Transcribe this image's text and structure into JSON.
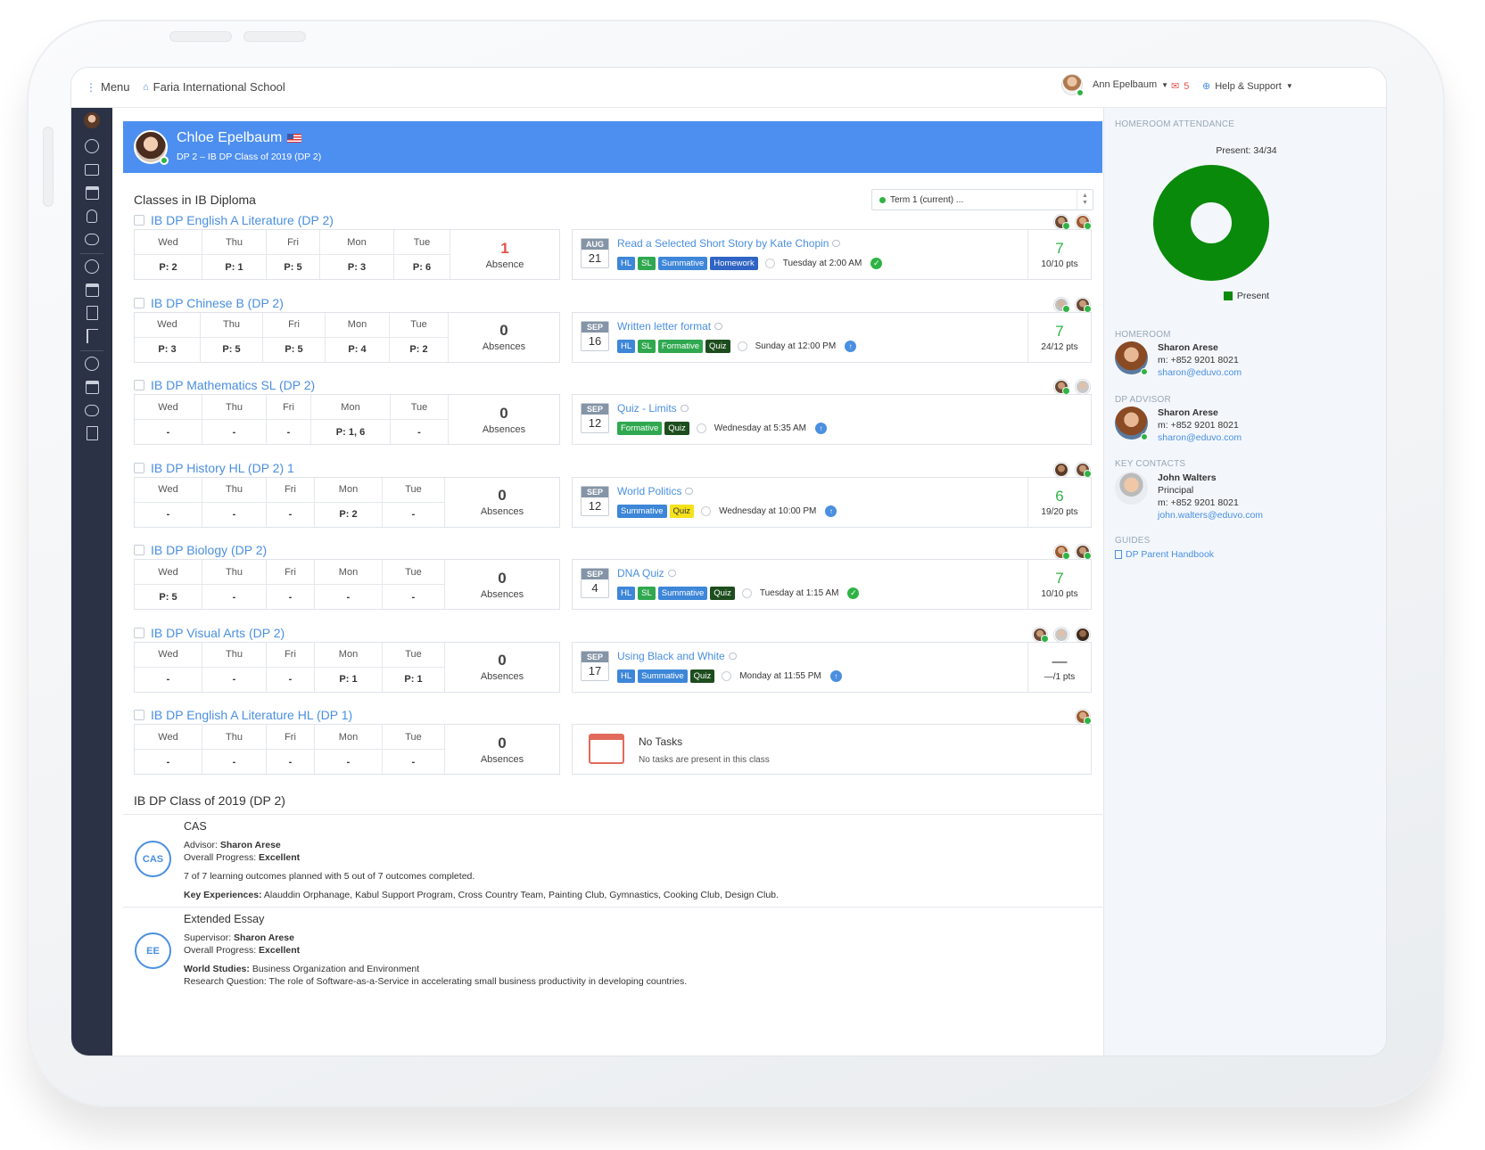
{
  "topbar": {
    "menu_label": "Menu",
    "school_name": "Faria International School",
    "user_name": "Ann Epelbaum",
    "messages_count": "5",
    "help_label": "Help & Support"
  },
  "student": {
    "name": "Chloe Epelbaum",
    "subtitle": "DP 2 – IB DP Class of 2019 (DP 2)"
  },
  "classes_section": {
    "title": "Classes in IB Diploma",
    "term_select": "Term 1 (current) ..."
  },
  "classes": [
    {
      "title": "IB DP English A Literature (DP 2)",
      "attendance": [
        [
          "Wed",
          "P: 2"
        ],
        [
          "Thu",
          "P: 1"
        ],
        [
          "Fri",
          "P: 5"
        ],
        [
          "Mon",
          "P: 3"
        ],
        [
          "Tue",
          "P: 6"
        ]
      ],
      "absence_count": "1",
      "absence_label": "Absence",
      "task": {
        "month": "AUG",
        "day": "21",
        "title": "Read a Selected Short Story by Kate Chopin",
        "tags": [
          "HL",
          "SL",
          "Summative",
          "Homework"
        ],
        "due": "Tuesday at 2:00 AM",
        "status": "done",
        "score": "7",
        "points": "10/10 pts"
      }
    },
    {
      "title": "IB DP Chinese B (DP 2)",
      "attendance": [
        [
          "Wed",
          "P: 3"
        ],
        [
          "Thu",
          "P: 5"
        ],
        [
          "Fri",
          "P: 5"
        ],
        [
          "Mon",
          "P: 4"
        ],
        [
          "Tue",
          "P: 2"
        ]
      ],
      "absence_count": "0",
      "absence_label": "Absences",
      "task": {
        "month": "SEP",
        "day": "16",
        "title": "Written letter format",
        "tags": [
          "HL",
          "SL",
          "Formative",
          "Quiz"
        ],
        "due": "Sunday at 12:00 PM",
        "status": "upload",
        "score": "7",
        "points": "24/12 pts"
      }
    },
    {
      "title": "IB DP Mathematics SL (DP 2)",
      "attendance": [
        [
          "Wed",
          "-"
        ],
        [
          "Thu",
          "-"
        ],
        [
          "Fri",
          "-"
        ],
        [
          "Mon",
          "P: 1, 6"
        ],
        [
          "Tue",
          "-"
        ]
      ],
      "absence_count": "0",
      "absence_label": "Absences",
      "task": {
        "month": "SEP",
        "day": "12",
        "title": "Quiz - Limits",
        "tags": [
          "Formative",
          "Quiz"
        ],
        "due": "Wednesday at 5:35 AM",
        "status": "upload",
        "score": "",
        "points": ""
      }
    },
    {
      "title": "IB DP History HL (DP 2) 1",
      "attendance": [
        [
          "Wed",
          "-"
        ],
        [
          "Thu",
          "-"
        ],
        [
          "Fri",
          "-"
        ],
        [
          "Mon",
          "P: 2"
        ],
        [
          "Tue",
          "-"
        ]
      ],
      "absence_count": "0",
      "absence_label": "Absences",
      "task": {
        "month": "SEP",
        "day": "12",
        "title": "World Politics",
        "tags": [
          "Summative",
          "Quiz"
        ],
        "due": "Wednesday at 10:00 PM",
        "status": "upload",
        "score": "6",
        "points": "19/20 pts"
      }
    },
    {
      "title": "IB DP Biology (DP 2)",
      "attendance": [
        [
          "Wed",
          "P: 5"
        ],
        [
          "Thu",
          "-"
        ],
        [
          "Fri",
          "-"
        ],
        [
          "Mon",
          "-"
        ],
        [
          "Tue",
          "-"
        ]
      ],
      "absence_count": "0",
      "absence_label": "Absences",
      "task": {
        "month": "SEP",
        "day": "4",
        "title": "DNA Quiz",
        "tags": [
          "HL",
          "SL",
          "Summative",
          "Quiz"
        ],
        "due": "Tuesday at 1:15 AM",
        "status": "done",
        "score": "7",
        "points": "10/10 pts"
      }
    },
    {
      "title": "IB DP Visual Arts (DP 2)",
      "attendance": [
        [
          "Wed",
          "-"
        ],
        [
          "Thu",
          "-"
        ],
        [
          "Fri",
          "-"
        ],
        [
          "Mon",
          "P: 1"
        ],
        [
          "Tue",
          "P: 1"
        ]
      ],
      "absence_count": "0",
      "absence_label": "Absences",
      "task": {
        "month": "SEP",
        "day": "17",
        "title": "Using Black and White",
        "tags": [
          "HL",
          "Summative",
          "Quiz"
        ],
        "due": "Monday at 11:55 PM",
        "status": "upload",
        "score": "—",
        "points": "—/1 pts"
      }
    },
    {
      "title": "IB DP English A Literature HL (DP 1)",
      "attendance": [
        [
          "Wed",
          "-"
        ],
        [
          "Thu",
          "-"
        ],
        [
          "Fri",
          "-"
        ],
        [
          "Mon",
          "-"
        ],
        [
          "Tue",
          "-"
        ]
      ],
      "absence_count": "0",
      "absence_label": "Absences",
      "no_tasks": {
        "title": "No Tasks",
        "text": "No tasks are present in this class"
      }
    }
  ],
  "program": {
    "title": "IB DP Class of 2019 (DP 2)",
    "cas": {
      "title": "CAS",
      "advisor_label": "Advisor:",
      "advisor": "Sharon Arese",
      "progress_label": "Overall Progress:",
      "progress": "Excellent",
      "outcomes": "7 of 7 learning outcomes planned with 5 out of 7 outcomes completed.",
      "key_label": "Key Experiences:",
      "key": "Alauddin Orphanage, Kabul Support Program, Cross Country Team, Painting Club, Gymnastics, Cooking Club, Design Club."
    },
    "ee": {
      "title": "Extended Essay",
      "supervisor_label": "Supervisor:",
      "supervisor": "Sharon Arese",
      "progress_label": "Overall Progress:",
      "progress": "Excellent",
      "ws_label": "World Studies:",
      "ws": "Business Organization and Environment",
      "rq": "Research Question: The role of Software-as-a-Service in accelerating small business productivity in developing countries."
    }
  },
  "right_panel": {
    "attendance_head": "Homeroom Attendance",
    "present_count": "Present: 34/34",
    "present_fraction": 1.0,
    "legend": "Present",
    "homeroom_head": "Homeroom",
    "homeroom": {
      "name": "Sharon Arese",
      "phone": "m: +852 9201 8021",
      "email": "sharon@eduvo.com"
    },
    "advisor_head": "DP Advisor",
    "advisor": {
      "name": "Sharon Arese",
      "phone": "m: +852 9201 8021",
      "email": "sharon@eduvo.com"
    },
    "contacts_head": "Key Contacts",
    "contact": {
      "name": "John Walters",
      "role": "Principal",
      "phone": "m: +852 9201 8021",
      "email": "john.walters@eduvo.com"
    },
    "guides_head": "Guides",
    "guide": "DP Parent Handbook"
  },
  "colors": {
    "accent": "#4d8ff0",
    "present": "#0a8a0a",
    "sidebar": "#2b3245"
  }
}
